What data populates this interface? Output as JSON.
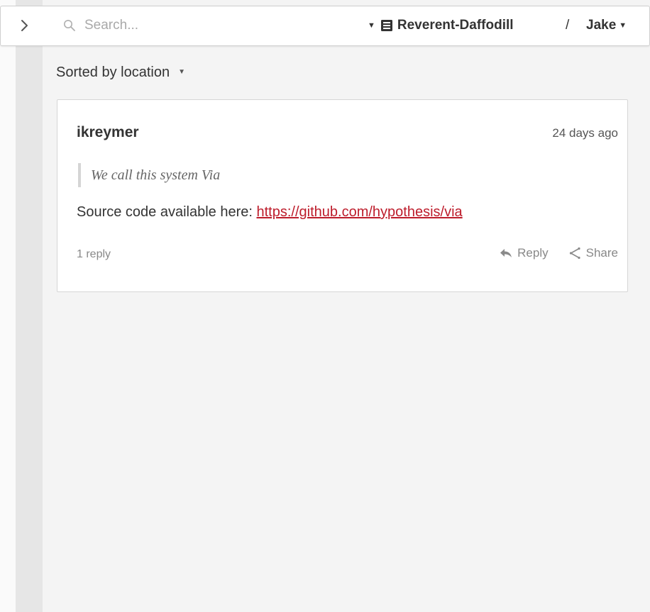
{
  "topbar": {
    "search": {
      "placeholder": "Search...",
      "value": ""
    },
    "group": {
      "name": "Reverent-Daffodill"
    },
    "separator": "/",
    "user": {
      "name": "Jake"
    }
  },
  "sort": {
    "label": "Sorted by location"
  },
  "annotation": {
    "author": "ikreymer",
    "timestamp": "24 days ago",
    "quote": "We call this system Via",
    "body_prefix": "Source code available here: ",
    "link_text": "https://github.com/hypothesis/via",
    "reply_count": "1 reply",
    "reply_label": "Reply",
    "share_label": "Share"
  },
  "colors": {
    "link": "#bd1c2b",
    "sidebar_background": "#f4f4f4",
    "text": "#333333"
  },
  "icons": {
    "collapse": "chevron-right-icon",
    "search": "search-icon",
    "group": "group-icon",
    "reply": "reply-arrow-icon",
    "share": "share-icon",
    "dropdown": "triangle-down-icon"
  }
}
